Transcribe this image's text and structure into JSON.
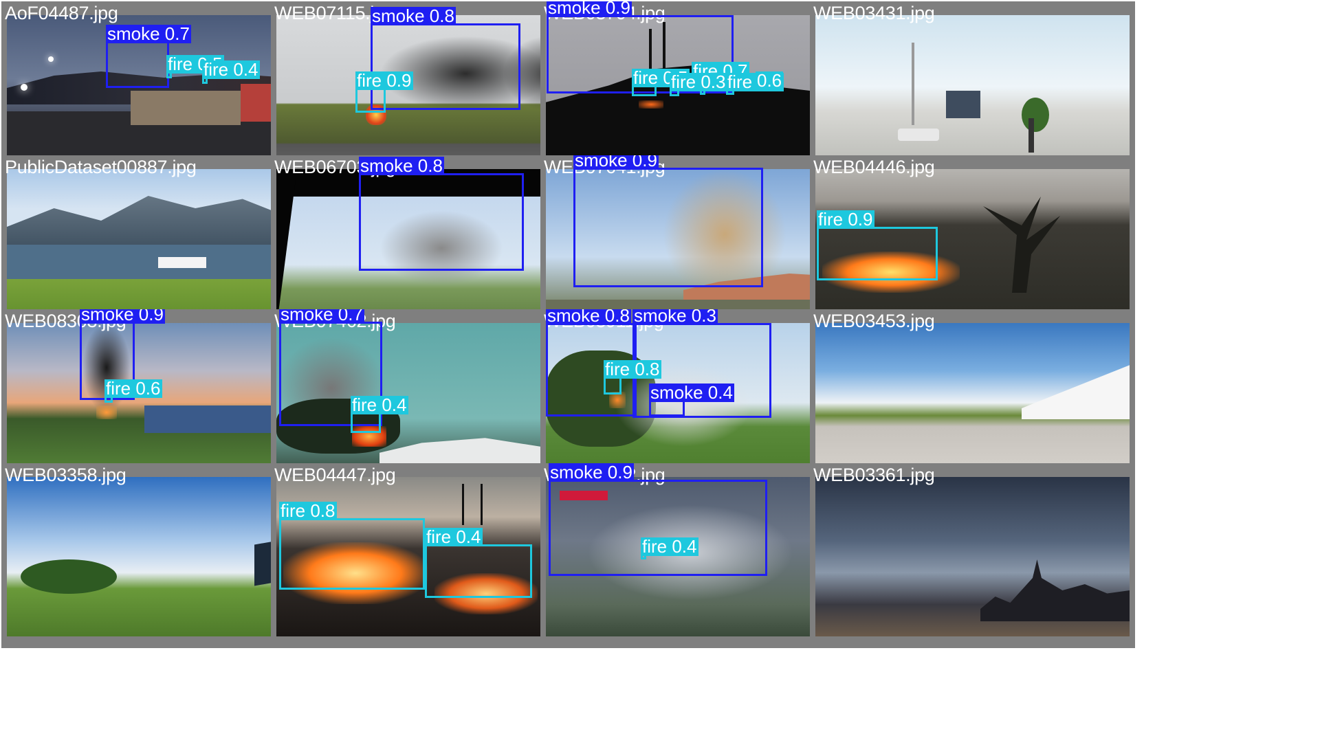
{
  "colors": {
    "smoke_box": "#1f1ff2",
    "fire_box": "#1ec8de",
    "cell_border": "#7f7f7f"
  },
  "images": [
    {
      "filename": "AoF04487.jpg",
      "scene": "dusk-town",
      "detections": [
        {
          "label": "smoke 0.7"
        },
        {
          "label": "fire 0.5"
        },
        {
          "label": "fire 0.4"
        }
      ]
    },
    {
      "filename": "WEB07115.jpg",
      "scene": "road-smoke",
      "detections": [
        {
          "label": "smoke 0.8"
        },
        {
          "label": "fire 0.9"
        }
      ]
    },
    {
      "filename": "WEB03704.jpg",
      "scene": "night-hill",
      "detections": [
        {
          "label": "smoke 0.9"
        },
        {
          "label": "fire 0.5"
        },
        {
          "label": "fire 0.7"
        },
        {
          "label": "fire 0.3"
        },
        {
          "label": "fire 0.3"
        },
        {
          "label": "0.6"
        }
      ]
    },
    {
      "filename": "WEB03431.jpg",
      "scene": "parking-lot",
      "detections": []
    },
    {
      "filename": "PublicDataset00887.jpg",
      "scene": "fjord-ship",
      "detections": []
    },
    {
      "filename": "WEB06703.jpg",
      "scene": "window-smoke",
      "detections": [
        {
          "label": "smoke 0.8"
        }
      ]
    },
    {
      "filename": "WEB07641.jpg",
      "scene": "tan-plume",
      "detections": [
        {
          "label": "smoke 0.9"
        }
      ]
    },
    {
      "filename": "WEB04446.jpg",
      "scene": "grass-fire",
      "detections": [
        {
          "label": "fire 0.9"
        }
      ]
    },
    {
      "filename": "WEB08303.jpg",
      "scene": "sunset-column",
      "detections": [
        {
          "label": "smoke 0.9"
        },
        {
          "label": "fire 0.6"
        }
      ]
    },
    {
      "filename": "WEB07462.jpg",
      "scene": "teal-sky-fire",
      "detections": [
        {
          "label": "smoke 0.7"
        },
        {
          "label": "fire 0.4"
        }
      ]
    },
    {
      "filename": "WEB03911.jpg",
      "scene": "valley-smoke",
      "detections": [
        {
          "label": "smoke 0.8"
        },
        {
          "label": "smoke 0.3"
        },
        {
          "label": "fire 0.8"
        },
        {
          "label": "smoke 0.4"
        }
      ]
    },
    {
      "filename": "WEB03453.jpg",
      "scene": "plaza",
      "detections": []
    },
    {
      "filename": "WEB03358.jpg",
      "scene": "park-sky",
      "detections": []
    },
    {
      "filename": "WEB04447.jpg",
      "scene": "night-grass-fire",
      "detections": [
        {
          "label": "fire 0.8"
        },
        {
          "label": "fire 0.4"
        }
      ]
    },
    {
      "filename": "WEB03522.jpg",
      "scene": "hazy-hills",
      "detections": [
        {
          "label": "smoke 0.9"
        },
        {
          "label": "fire 0.4"
        }
      ]
    },
    {
      "filename": "WEB03361.jpg",
      "scene": "city-storm",
      "detections": []
    }
  ]
}
